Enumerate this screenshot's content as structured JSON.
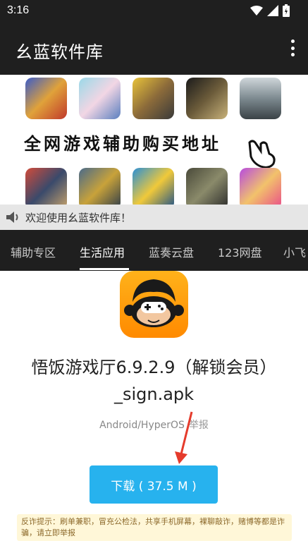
{
  "status_bar": {
    "time": "3:16"
  },
  "app_bar": {
    "title": "幺蓝软件库"
  },
  "banner": {
    "text": "全网游戏辅助购买地址",
    "games_row1": [
      "game-1",
      "game-2",
      "game-3",
      "game-4",
      "game-5"
    ],
    "games_row2": [
      "game-6",
      "game-7",
      "game-8",
      "game-9",
      "game-10"
    ]
  },
  "notice": {
    "text": "欢迎使用幺蓝软件库！"
  },
  "tabs": [
    {
      "label": "辅助专区"
    },
    {
      "label": "生活应用"
    },
    {
      "label": "蓝奏云盘"
    },
    {
      "label": "123网盘"
    },
    {
      "label": "小飞"
    }
  ],
  "active_tab": "生活应用",
  "file": {
    "name_line1": "悟饭游戏厅6.9.2.9（解锁会员）",
    "name_line2": "_sign.apk",
    "platform": "Android/HyperOS",
    "report": "举报"
  },
  "download": {
    "label": "下载 ( 37.5 M )"
  },
  "warning": {
    "text": "反诈提示：刷单兼职，冒充公检法，共享手机屏幕，裸聊敲诈，赌博等都是诈骗，请立即举报"
  },
  "colors": {
    "accent": "#27b2ee",
    "bar": "#1f1f1f",
    "arrow": "#e53b2c"
  }
}
